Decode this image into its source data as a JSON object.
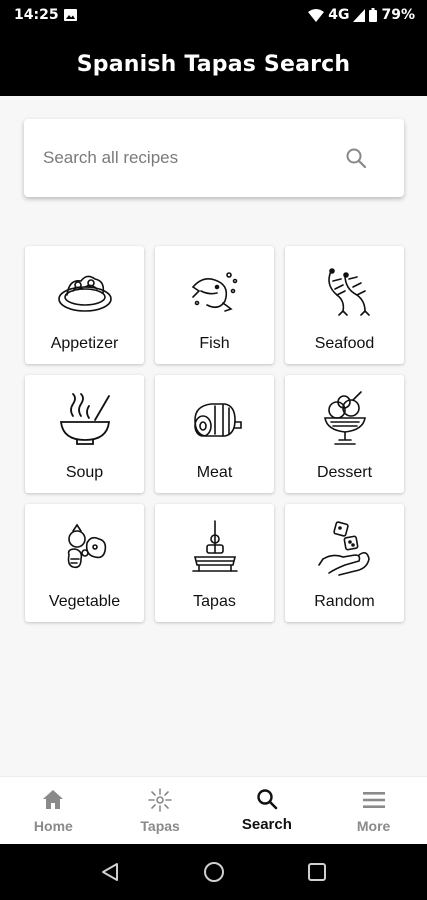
{
  "status_bar": {
    "time": "14:25",
    "network": "4G",
    "battery": "79%",
    "icons": [
      "image-notification-icon",
      "wifi-icon",
      "signal-icon",
      "battery-icon"
    ]
  },
  "app_bar": {
    "title": "Spanish Tapas Search"
  },
  "search": {
    "placeholder": "Search all recipes",
    "icon": "search-icon"
  },
  "categories": [
    {
      "label": "Appetizer",
      "icon": "appetizer-platter-icon"
    },
    {
      "label": "Fish",
      "icon": "fish-icon"
    },
    {
      "label": "Seafood",
      "icon": "shrimp-icon"
    },
    {
      "label": "Soup",
      "icon": "soup-bowl-icon"
    },
    {
      "label": "Meat",
      "icon": "meat-ham-icon"
    },
    {
      "label": "Dessert",
      "icon": "ice-cream-sundae-icon"
    },
    {
      "label": "Vegetable",
      "icon": "vegetables-icon"
    },
    {
      "label": "Tapas",
      "icon": "tapas-skewer-icon"
    },
    {
      "label": "Random",
      "icon": "dice-hand-icon"
    }
  ],
  "bottom_nav": {
    "items": [
      {
        "label": "Home",
        "icon": "home-icon",
        "active": false
      },
      {
        "label": "Tapas",
        "icon": "tapas-sparkle-icon",
        "active": false
      },
      {
        "label": "Search",
        "icon": "search-icon",
        "active": true
      },
      {
        "label": "More",
        "icon": "menu-icon",
        "active": false
      }
    ]
  },
  "system_nav": {
    "buttons": [
      "back-icon",
      "home-circle-icon",
      "recents-square-icon"
    ]
  },
  "colors": {
    "app_bar_bg": "#000000",
    "app_bar_text": "#ffffff",
    "page_bg": "#f7f7f7",
    "card_bg": "#ffffff",
    "active_nav": "#111111",
    "inactive_nav": "#8a8a8a"
  }
}
